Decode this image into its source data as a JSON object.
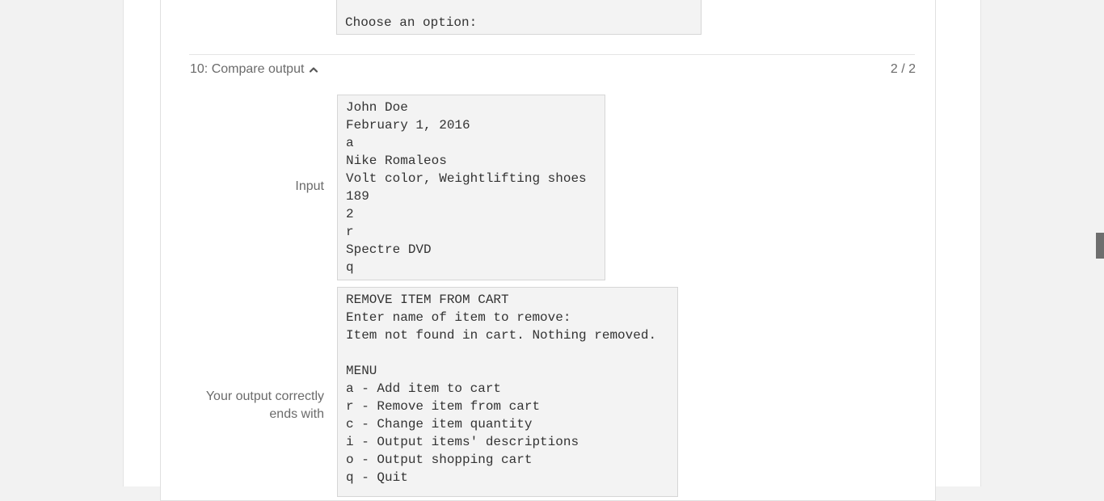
{
  "previous_output": {
    "text": "Choose an option:"
  },
  "test_case": {
    "title": "10: Compare output",
    "score": "2 / 2",
    "input_label": "Input",
    "input_text": "John Doe\nFebruary 1, 2016\na\nNike Romaleos\nVolt color, Weightlifting shoes\n189\n2\nr\nSpectre DVD\nq",
    "output_label_line1": "Your output correctly",
    "output_label_line2": "ends with",
    "output_text": "REMOVE ITEM FROM CART\nEnter name of item to remove:\nItem not found in cart. Nothing removed.\n\nMENU\na - Add item to cart\nr - Remove item from cart\nc - Change item quantity\ni - Output items' descriptions\no - Output shopping cart\nq - Quit"
  },
  "icons": {
    "collapse": "chevron-up-icon"
  }
}
